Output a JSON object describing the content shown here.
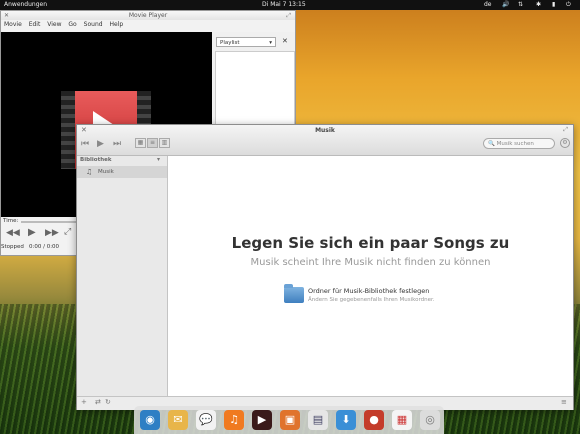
{
  "topbar": {
    "apps_label": "Anwendungen",
    "clock": "Di Mai  7 13:15",
    "language": "de"
  },
  "movie_player": {
    "title": "Movie Player",
    "menu": [
      "Movie",
      "Edit",
      "View",
      "Go",
      "Sound",
      "Help"
    ],
    "playlist_select": "Playlist",
    "time_label": "Time:",
    "status": "Stopped",
    "time_value": "0:00 / 0:00"
  },
  "music": {
    "title": "Musik",
    "search_placeholder": "Musik suchen",
    "sidebar_header": "Bibliothek",
    "sidebar_item": "Musik",
    "headline": "Legen Sie sich ein paar Songs zu",
    "subheadline": "Musik scheint Ihre Musik nicht finden zu können",
    "action_title": "Ordner für Musik-Bibliothek festlegen",
    "action_subtitle": "Ändern Sie gegebenenfalls Ihren Musikordner."
  },
  "dock_icons": [
    "browser-icon",
    "mail-icon",
    "chat-icon",
    "music-icon",
    "video-icon",
    "photos-icon",
    "files-icon",
    "software-icon",
    "games-icon",
    "calendar-icon",
    "disc-icon"
  ]
}
